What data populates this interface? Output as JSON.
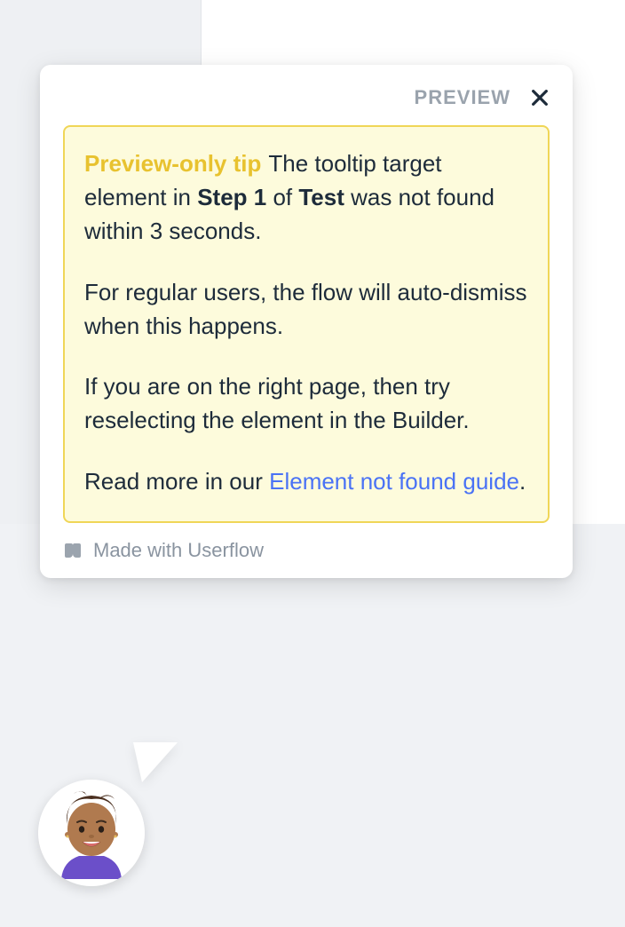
{
  "header": {
    "preview_label": "PREVIEW"
  },
  "tip": {
    "badge": "Preview-only tip",
    "p1_before": "The tooltip target element in ",
    "p1_step": "Step 1",
    "p1_middle": " of ",
    "p1_test": "Test",
    "p1_after": " was not found within 3 seconds.",
    "p2": "For regular users, the flow will auto-dismiss when this happens.",
    "p3": "If you are on the right page, then try reselecting the element in the Builder.",
    "p4_before": "Read more in our ",
    "p4_link": "Element not found guide",
    "p4_after": "."
  },
  "footer": {
    "label": "Made with Userflow"
  }
}
